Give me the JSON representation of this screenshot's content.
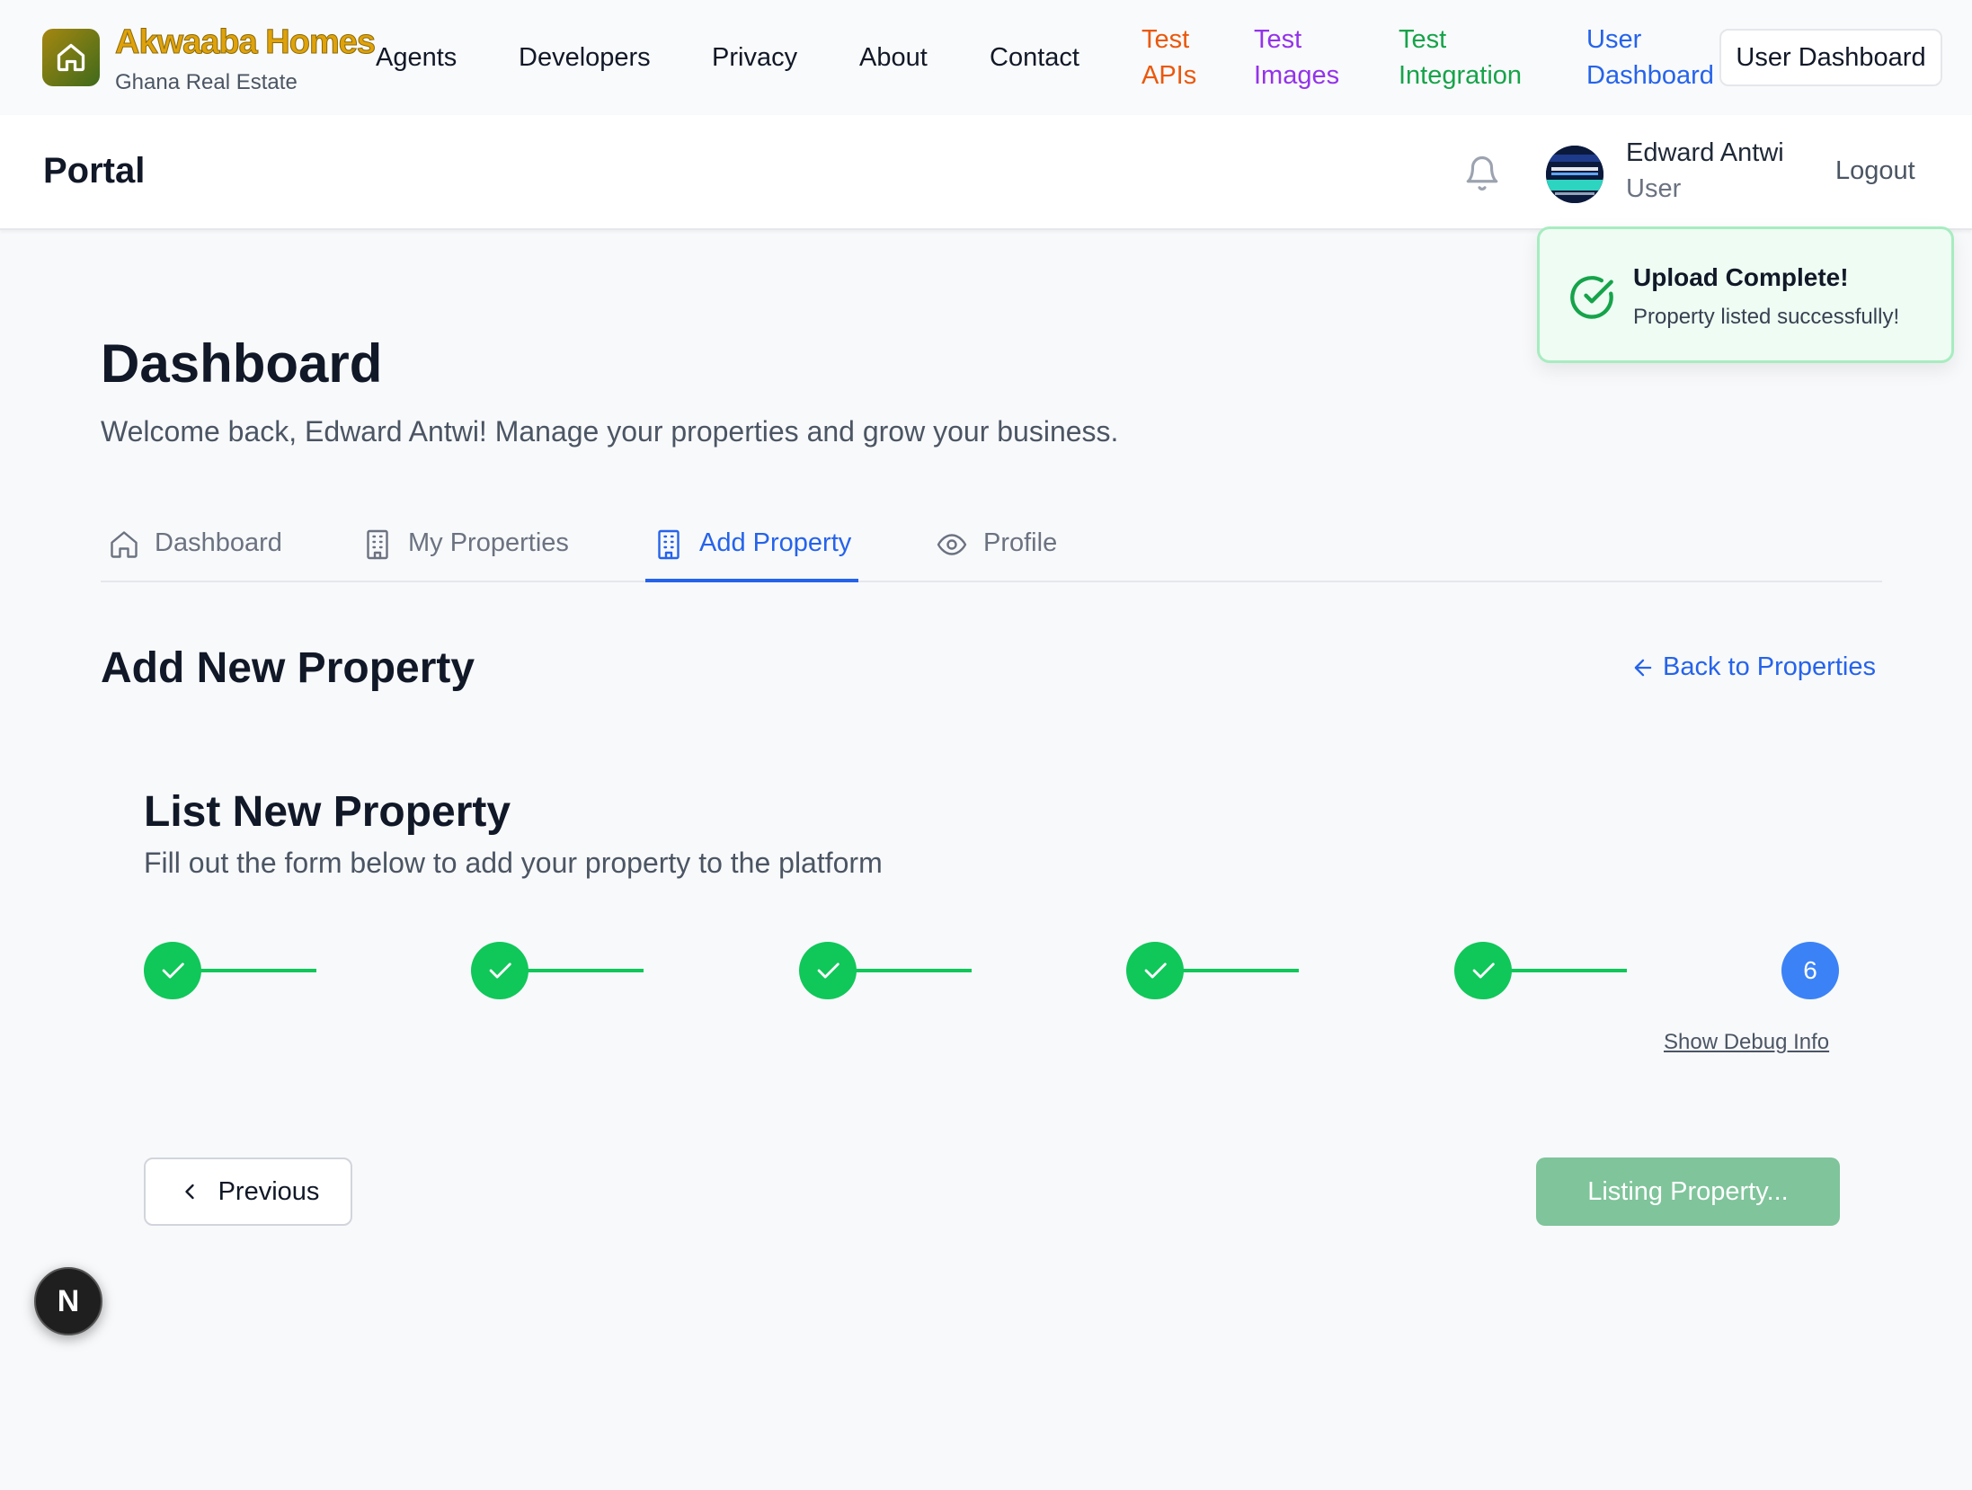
{
  "brand": {
    "name": "Akwaaba Homes",
    "subtitle": "Ghana Real Estate"
  },
  "nav": {
    "agents": "Agents",
    "developers": "Developers",
    "privacy": "Privacy",
    "about": "About",
    "contact": "Contact",
    "test_apis": [
      "Test",
      "APIs"
    ],
    "test_images": [
      "Test",
      "Images"
    ],
    "test_integration": [
      "Test",
      "Integration"
    ],
    "user_dashboard_link": [
      "User",
      "Dashboard"
    ],
    "user_dashboard_button": "User Dashboard",
    "colors": {
      "test_apis": "#ea580c",
      "test_images": "#9333ea",
      "test_integration": "#16a34a",
      "user_dashboard": "#2563eb"
    }
  },
  "portal": {
    "title": "Portal",
    "user_name": "Edward Antwi",
    "user_role": "User",
    "logout": "Logout"
  },
  "toast": {
    "title": "Upload Complete!",
    "message": "Property listed successfully!"
  },
  "main": {
    "title": "Dashboard",
    "subtitle": "Welcome back, Edward Antwi! Manage your properties and grow your business.",
    "tabs": [
      {
        "label": "Dashboard",
        "icon": "home-icon"
      },
      {
        "label": "My Properties",
        "icon": "building-icon"
      },
      {
        "label": "Add Property",
        "icon": "building-icon",
        "active": true
      },
      {
        "label": "Profile",
        "icon": "eye-icon"
      }
    ],
    "section_title": "Add New Property",
    "back_link": "Back to Properties"
  },
  "form": {
    "title": "List New Property",
    "subtitle": "Fill out the form below to add your property to the platform",
    "steps": [
      {
        "status": "complete"
      },
      {
        "status": "complete"
      },
      {
        "status": "complete"
      },
      {
        "status": "complete"
      },
      {
        "status": "complete"
      },
      {
        "status": "current",
        "label": "6"
      }
    ],
    "debug_link": "Show Debug Info",
    "previous_button": "Previous",
    "submit_button": "Listing Property..."
  },
  "dev_badge": "N"
}
